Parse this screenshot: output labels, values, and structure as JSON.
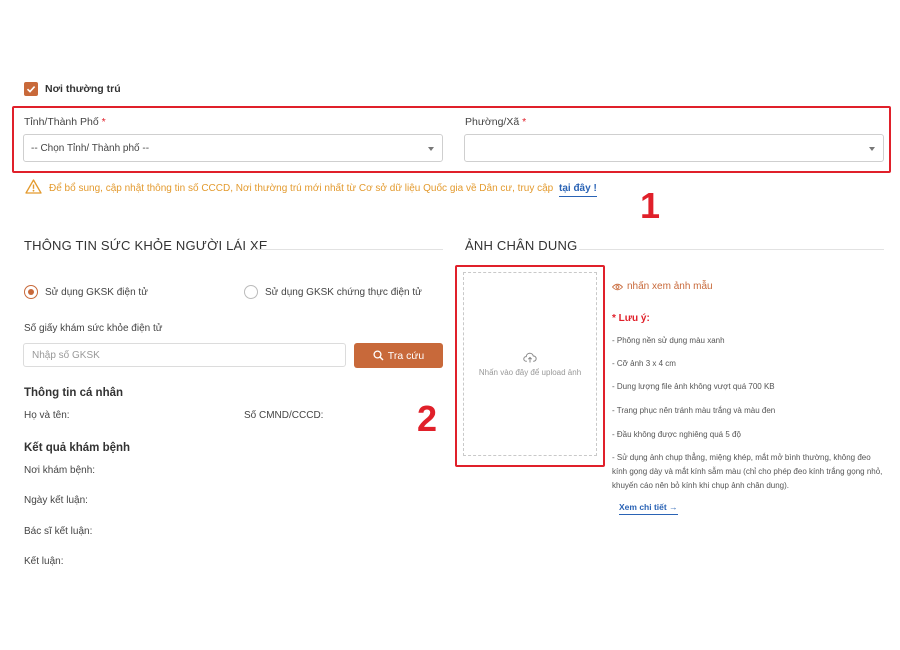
{
  "residence": {
    "checkbox_label": "Nơi thường trú",
    "checked": true,
    "province_label": "Tỉnh/Thành Phố",
    "province_value": "-- Chọn Tỉnh/ Thành phố --",
    "ward_label": "Phường/Xã",
    "ward_value": "",
    "required_mark": "*",
    "warning_text": "Để bổ sung, cập nhật thông tin số CCCD, Nơi thường trú mới nhất từ Cơ sở dữ liệu Quốc gia về Dân cư, truy cập",
    "warning_link": "tại đây !"
  },
  "annotations": [
    "1",
    "2"
  ],
  "health": {
    "title": "THÔNG TIN SỨC KHỎE NGƯỜI LÁI XE",
    "radio_electronic": "Sử dụng GKSK điện tử",
    "radio_certified": "Sử dụng GKSK chứng thực điện tử",
    "selected_option": "Sử dụng GKSK điện tử",
    "cert_label": "Số giấy khám sức khỏe điện tử",
    "cert_placeholder": "Nhập số GKSK",
    "search_button": "Tra cứu",
    "personal_title": "Thông tin cá nhân",
    "name_label": "Họ và tên:",
    "id_label": "Số CMND/CCCD:",
    "result_title": "Kết quả khám bệnh",
    "place_label": "Nơi khám bệnh:",
    "date_label": "Ngày kết luận:",
    "doctor_label": "Bác sĩ kết luận:",
    "conclusion_label": "Kết luận:"
  },
  "portrait": {
    "title": "ẢNH CHÂN DUNG",
    "upload_text": "Nhấn vào đây để upload ảnh",
    "sample_link": "nhấn xem ảnh mẫu",
    "notes_title": "* Lưu ý:",
    "notes": [
      "- Phông nền sử dụng màu xanh",
      "- Cỡ ảnh 3 x 4 cm",
      "- Dung lượng file ảnh không vượt quá 700 KB",
      "- Trang phục nên tránh màu trắng và màu đen",
      "- Đầu không được nghiêng quá 5 độ",
      "- Sử dụng ảnh chụp thẳng, miệng khép, mắt mở bình thường, không đeo kính gọng dày và mắt kính sẫm màu (chỉ cho phép đeo kính trắng gọng nhỏ, khuyến cáo nên bỏ kính khi chụp ảnh chân dung)."
    ],
    "detail_link": "Xem chi tiết →"
  },
  "colors": {
    "accent": "#c8693a",
    "highlight": "#e0202a",
    "warning": "#e39a2e",
    "link": "#2a63b5"
  },
  "icons": [
    "check-icon",
    "chevron-down-icon",
    "warning-icon",
    "search-icon",
    "cloud-upload-icon",
    "eye-icon"
  ]
}
